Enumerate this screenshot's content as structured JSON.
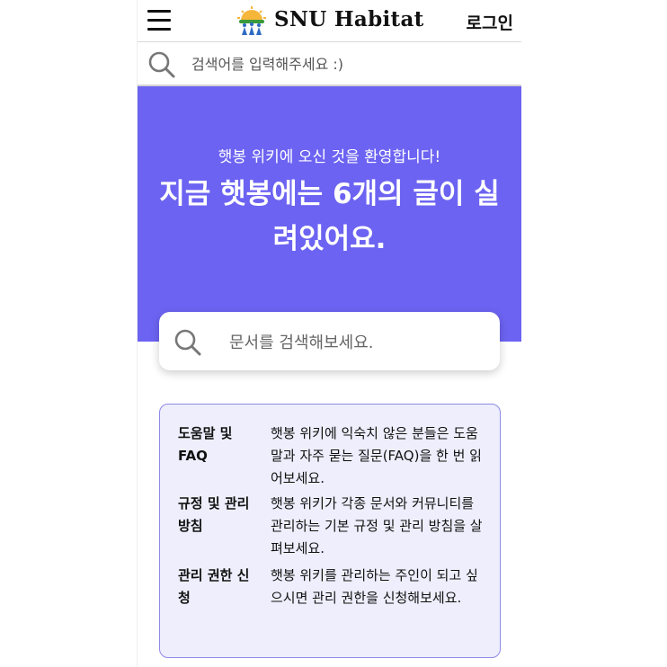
{
  "header": {
    "brand": "SNU Habitat",
    "login_label": "로그인"
  },
  "top_search": {
    "placeholder": "검색어를 입력해주세요 :)"
  },
  "hero": {
    "subtitle": "햇봉 위키에 오신 것을 환영합니다!",
    "headline": "지금 햇봉에는 6개의 글이 실려있어요.",
    "accent_color": "#6c63f2"
  },
  "main_search": {
    "placeholder": "문서를 검색해보세요."
  },
  "info": {
    "items": [
      {
        "title": "도움말 및 FAQ",
        "desc": "햇봉 위키에 익숙치 않은 분들은 도움말과 자주 묻는 질문(FAQ)을 한 번 읽어보세요."
      },
      {
        "title": "규정 및 관리 방침",
        "desc": "햇봉 위키가 각종 문서와 커뮤니티를 관리하는 기본 규정 및 관리 방침을 살펴보세요."
      },
      {
        "title": "관리 권한 신청",
        "desc": "햇봉 위키를 관리하는 주인이 되고 싶으시면 관리 권한을 신청해보세요."
      }
    ]
  }
}
